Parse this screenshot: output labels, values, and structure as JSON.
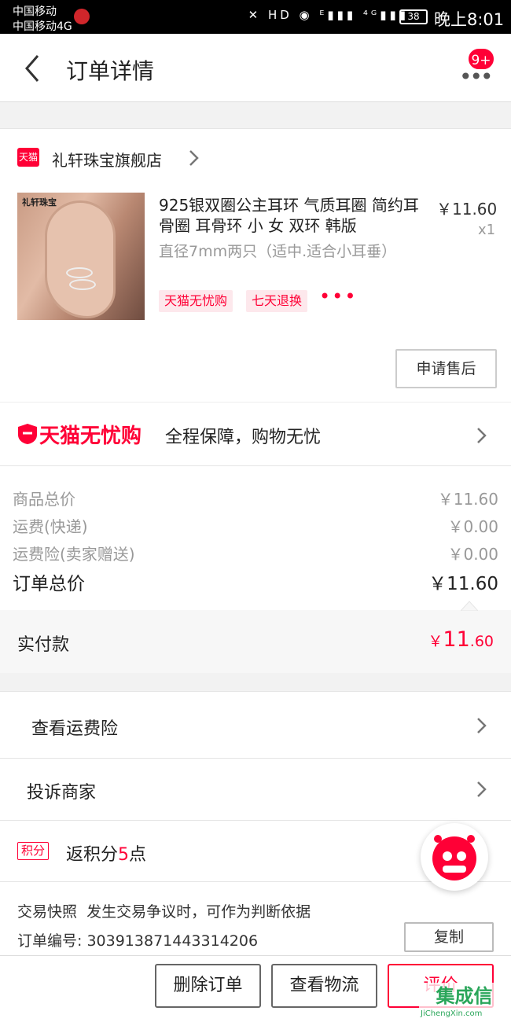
{
  "status_bar": {
    "carrier_1": "中国移动",
    "carrier_2": "中国移动4G",
    "icons": "✕ HD ◉ ᴱ▮▮▮ ⁴ᴳ▮▮▮",
    "battery": "38",
    "time": "晚上8:01"
  },
  "header": {
    "title": "订单详情",
    "more_icon": "•••",
    "badge": "9+"
  },
  "store": {
    "platform_badge": "天猫",
    "name": "礼轩珠宝旗舰店"
  },
  "product": {
    "thumb_brand": "礼轩珠宝",
    "name": "925银双圈公主耳环 气质耳圈 简约耳骨圈 耳骨环 小 女 双环 韩版",
    "price": "￥11.60",
    "quantity": "x1",
    "spec": "直径7mm两只（适中.适合小耳垂）",
    "tags": [
      "天猫无忧购",
      "七天退换"
    ],
    "more_tags": "•••",
    "after_sale_button": "申请售后"
  },
  "guarantee": {
    "brand": "天猫无忧购",
    "text": "全程保障，购物无忧"
  },
  "summary": {
    "rows": [
      {
        "label": "商品总价",
        "value": "￥11.60"
      },
      {
        "label": "运费(快递)",
        "value": "￥0.00"
      },
      {
        "label": "运费险(卖家赠送)",
        "value": "￥0.00"
      }
    ],
    "total_label": "订单总价",
    "total_value": "￥11.60",
    "paid_label": "实付款",
    "paid_currency": "￥",
    "paid_int": "11",
    "paid_dec": ".60"
  },
  "links": {
    "shipping_insurance": "查看运费险",
    "complain": "投诉商家"
  },
  "points": {
    "badge": "积分",
    "text_prefix": "返积分",
    "amount": "5",
    "text_suffix": "点"
  },
  "snapshot": {
    "title": "交易快照",
    "desc": "发生交易争议时，可作为判断依据",
    "order_label": "订单编号: ",
    "order_no": "303913871443314206",
    "copy_button": "复制"
  },
  "actions": {
    "delete": "删除订单",
    "logistics": "查看物流",
    "review": "评价"
  },
  "watermark": {
    "text": "集成信",
    "url": "JiChengXin.com"
  },
  "colors": {
    "accent": "#ff0036",
    "muted": "#999999"
  }
}
